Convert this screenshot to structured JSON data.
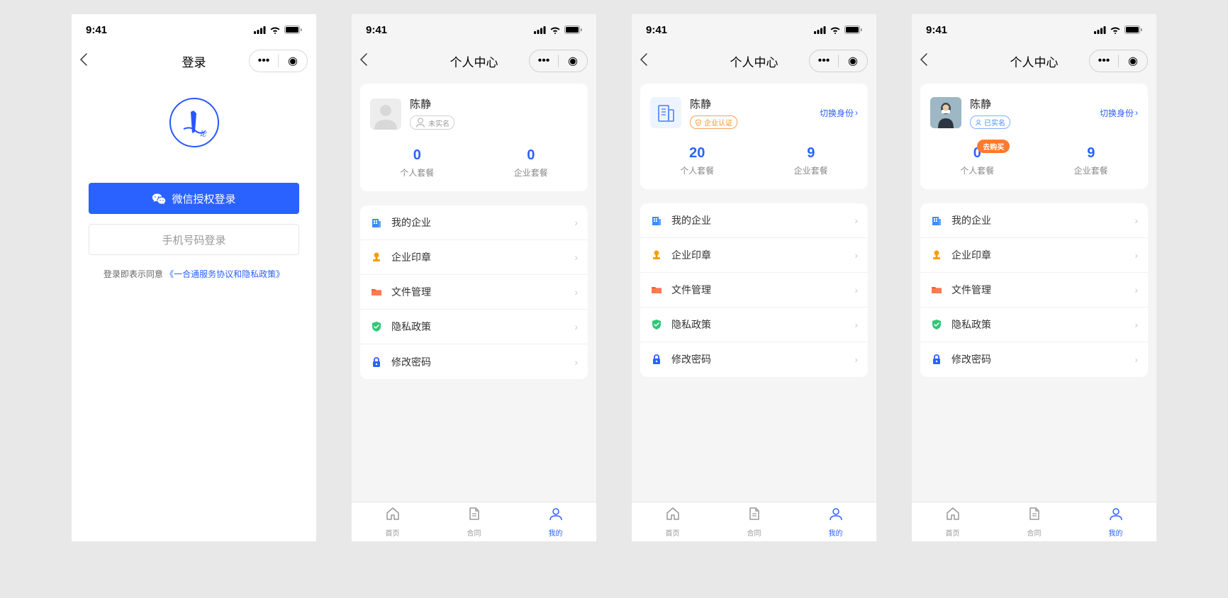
{
  "statusbar": {
    "time": "9:41"
  },
  "navbar": {
    "login_title": "登录",
    "profile_title": "个人中心"
  },
  "login": {
    "wechat_btn": "微信授权登录",
    "phone_btn": "手机号码登录",
    "agree_prefix": "登录即表示同意",
    "agree_link": "《一合通服务协议和隐私政策》"
  },
  "profile": {
    "name": "陈静",
    "badge_unverified": "未实名",
    "badge_enterprise": "企业认证",
    "badge_verified": "已实名",
    "switch_identity": "切换身份",
    "buy_badge": "去购买"
  },
  "stats": {
    "personal_label": "个人套餐",
    "enterprise_label": "企业套餐",
    "s1": {
      "personal": "0",
      "enterprise": "0"
    },
    "s2": {
      "personal": "20",
      "enterprise": "9"
    },
    "s3": {
      "personal": "0",
      "enterprise": "9"
    }
  },
  "menu": {
    "my_company": "我的企业",
    "company_seal": "企业印章",
    "file_mgmt": "文件管理",
    "privacy": "隐私政策",
    "change_pwd": "修改密码"
  },
  "tabs": {
    "home": "首页",
    "contract": "合同",
    "mine": "我的"
  },
  "colors": {
    "primary": "#2a62ff",
    "orange": "#f5911e",
    "badge_orange": "#ff7a2e"
  }
}
